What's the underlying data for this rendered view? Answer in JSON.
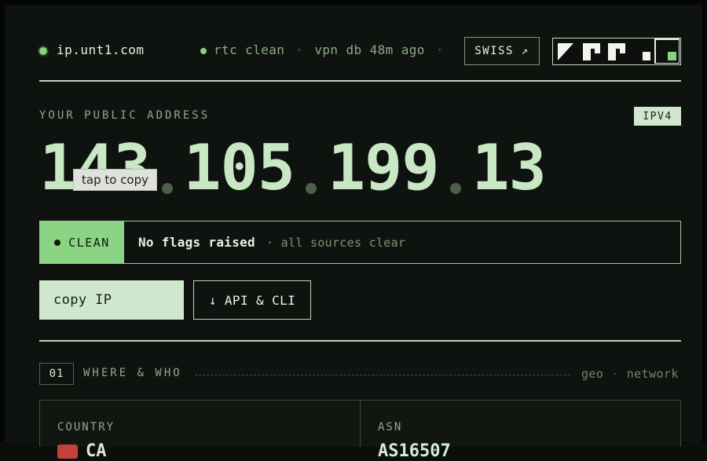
{
  "header": {
    "brand": "ip.unt1.com",
    "status_rtc": "rtc clean",
    "status_sep": "·",
    "status_vpn": "vpn db 48m ago",
    "swiss_label": "SWISS ↗",
    "colors": {
      "accent": "#86d27f",
      "background": "#0f130f",
      "text": "#d6ecd4"
    }
  },
  "address": {
    "section_label": "YOUR PUBLIC ADDRESS",
    "version_badge": "IPV4",
    "octets": [
      "143",
      "105",
      "199",
      "13"
    ],
    "tooltip": "tap to copy"
  },
  "status": {
    "badge": "CLEAN",
    "headline": "No flags raised",
    "detail": "· all sources clear"
  },
  "actions": {
    "copy_label": "copy IP",
    "api_label": "↓ API & CLI"
  },
  "section01": {
    "number": "01",
    "title": "WHERE & WHO",
    "tag_geo": "geo",
    "tag_sep": "·",
    "tag_network": "network",
    "cards": [
      {
        "label": "COUNTRY",
        "value": "CA"
      },
      {
        "label": "ASN",
        "value": "AS16507"
      }
    ]
  }
}
